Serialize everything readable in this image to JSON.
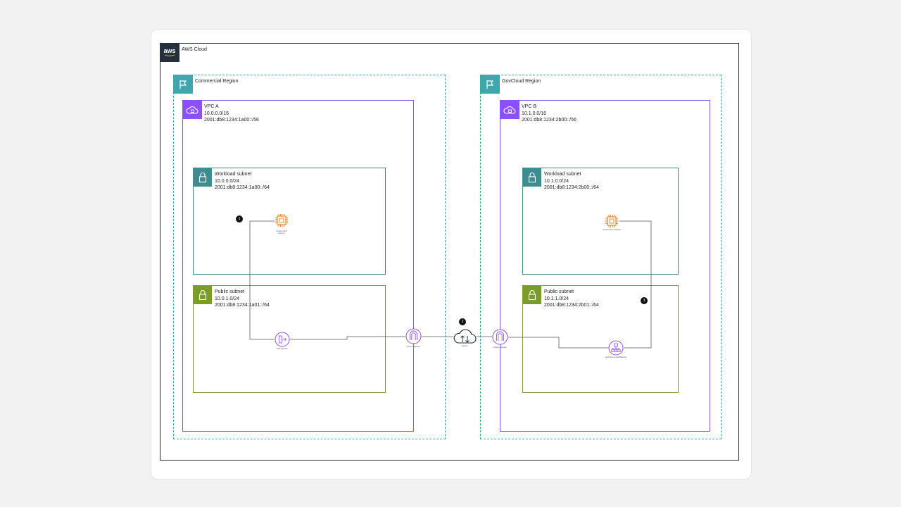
{
  "cloud": {
    "logo_text": "aws",
    "title": "AWS Cloud"
  },
  "regions": {
    "commercial": {
      "title": "Commercial Region",
      "vpc": {
        "name": "VPC A",
        "ipv4": "10.0.0.0/16",
        "ipv6": "2001:db8:1234:1a00::/56"
      },
      "workload_subnet": {
        "name": "Workload subnet",
        "ipv4": "10.0.0.0/24",
        "ipv6": "2001:db8:1234:1a00::/64"
      },
      "public_subnet": {
        "name": "Public subnet",
        "ipv4": "10.0.1.0/24",
        "ipv6": "2001:db8:1234:1a01::/64"
      },
      "ec2_label": [
        "Amazon EC2",
        "instance"
      ],
      "nat_label": "NAT gateway",
      "igw_label": "Internet gateway"
    },
    "govcloud": {
      "title": "GovCloud Region",
      "vpc": {
        "name": "VPC B",
        "ipv4": "10.1.0.0/16",
        "ipv6": "2001:db8:1234:2b00::/56"
      },
      "workload_subnet": {
        "name": "Workload subnet",
        "ipv4": "10.1.0.0/24",
        "ipv6": "2001:db8:1234:2b00::/64"
      },
      "public_subnet": {
        "name": "Public subnet",
        "ipv4": "10.1.1.0/24",
        "ipv6": "2001:db8:1234:2b01::/64"
      },
      "ec2_label": "Amazon EC2 instance",
      "igw_label": "Internet gateway",
      "alb_label": "Application Load Balancer"
    }
  },
  "internet_label": "Internet",
  "steps": [
    "1",
    "2",
    "3"
  ],
  "colors": {
    "cloud_border": "#232f3e",
    "region": "#3fa6ac",
    "vpc": "#8c4fff",
    "workload_subnet": "#3f8c90",
    "public_subnet": "#7a9c2a",
    "ec2": "#ed7100"
  },
  "icons": {
    "region": "flag-icon",
    "vpc": "vpc-cloud-icon",
    "subnet": "lock-icon",
    "ec2": "ec2-chip-icon",
    "nat": "nat-gateway-icon",
    "igw": "internet-gateway-icon",
    "internet": "internet-cloud-icon",
    "alb": "load-balancer-icon"
  }
}
